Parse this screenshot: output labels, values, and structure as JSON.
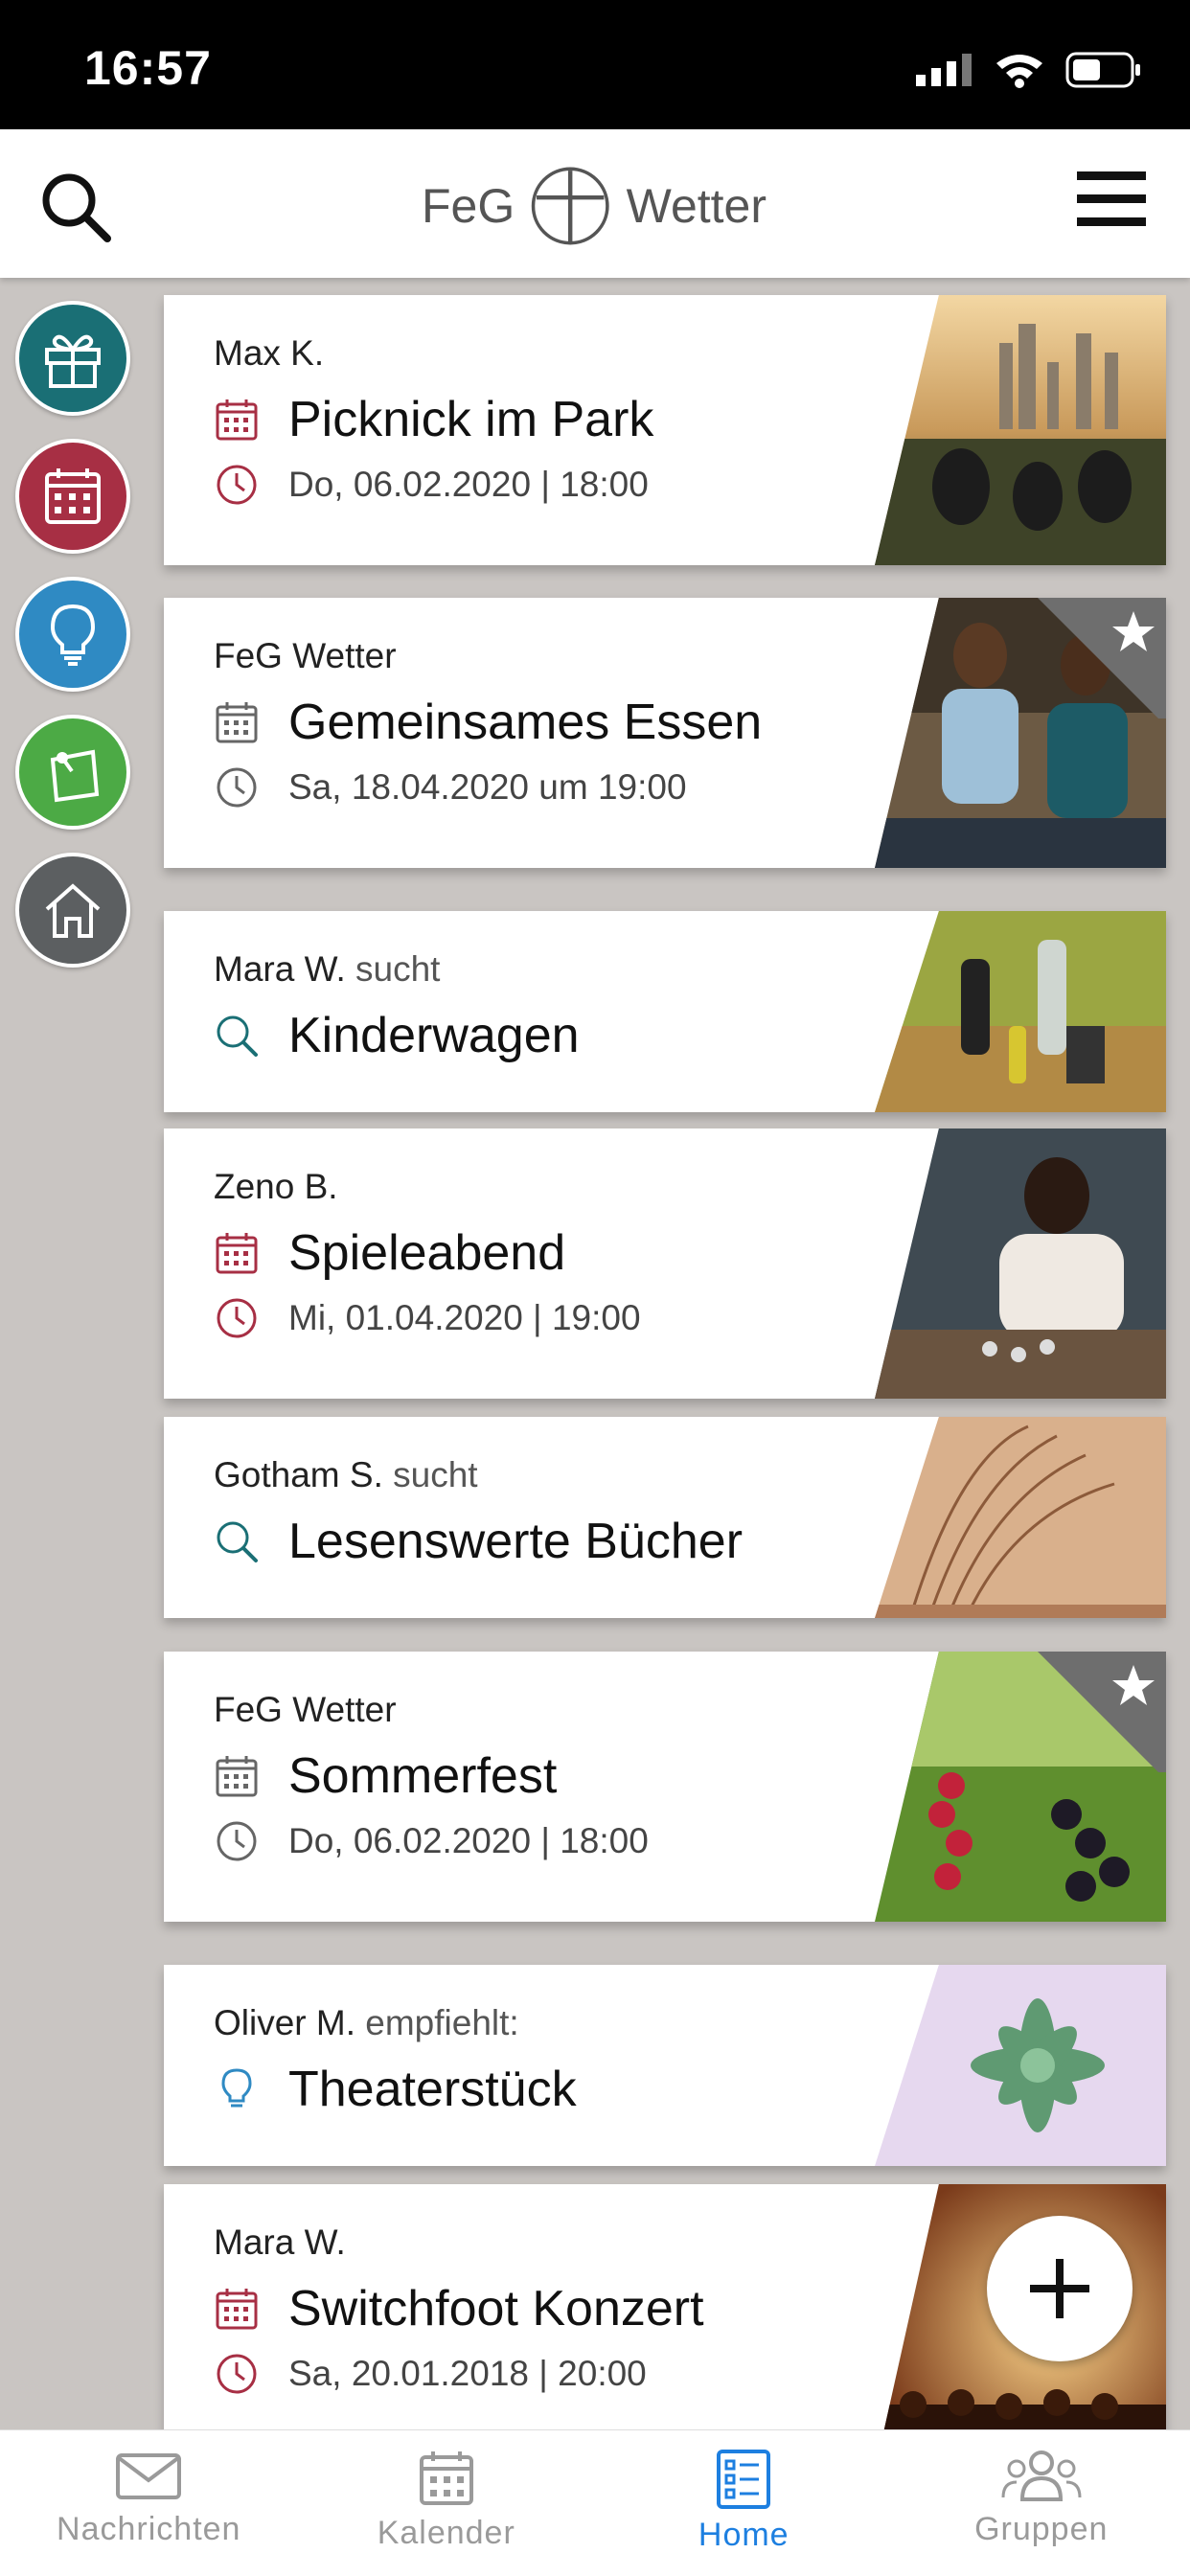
{
  "status_bar": {
    "time": "16:57"
  },
  "header": {
    "logo_left": "FeG",
    "logo_right": "Wetter",
    "search_icon": "search-icon",
    "menu_icon": "hamburger-menu-icon"
  },
  "sidebar": {
    "items": [
      {
        "name": "gift",
        "color": "#1a6f75"
      },
      {
        "name": "calendar",
        "color": "#a72f44"
      },
      {
        "name": "lightbulb",
        "color": "#2f8ac3"
      },
      {
        "name": "note",
        "color": "#4caa45"
      },
      {
        "name": "home",
        "color": "#5c5f61"
      }
    ]
  },
  "feed": [
    {
      "author": "Max K.",
      "suffix": "",
      "title": "Picknick im Park",
      "date": "Do, 06.02.2020 | 18:00",
      "accent": "#a72f44",
      "featured": false
    },
    {
      "author": "FeG Wetter",
      "suffix": "",
      "title": "Gemeinsames Essen",
      "date": "Sa, 18.04.2020 um 19:00",
      "accent": "#666666",
      "featured": true
    },
    {
      "author": "Mara W.",
      "suffix": "sucht",
      "title": "Kinderwagen",
      "date": "",
      "accent": "#1a6f75",
      "featured": false
    },
    {
      "author": "Zeno B.",
      "suffix": "",
      "title": "Spieleabend",
      "date": "Mi, 01.04.2020 | 19:00",
      "accent": "#a72f44",
      "featured": false
    },
    {
      "author": "Gotham S.",
      "suffix": "sucht",
      "title": "Lesenswerte Bücher",
      "date": "",
      "accent": "#1a6f75",
      "featured": false
    },
    {
      "author": "FeG Wetter",
      "suffix": "",
      "title": "Sommerfest",
      "date": "Do, 06.02.2020 | 18:00",
      "accent": "#666666",
      "featured": true
    },
    {
      "author": "Oliver M.",
      "suffix": "empfiehlt:",
      "title": "Theaterstück",
      "date": "",
      "accent": "#2f8ac3",
      "featured": false
    },
    {
      "author": "Mara W.",
      "suffix": "",
      "title": "Switchfoot Konzert",
      "date": "Sa, 20.01.2018 | 20:00",
      "accent": "#a72f44",
      "featured": false
    }
  ],
  "tabs": [
    {
      "label": "Nachrichten",
      "active": false
    },
    {
      "label": "Kalender",
      "active": false
    },
    {
      "label": "Home",
      "active": true
    },
    {
      "label": "Gruppen",
      "active": false
    }
  ]
}
